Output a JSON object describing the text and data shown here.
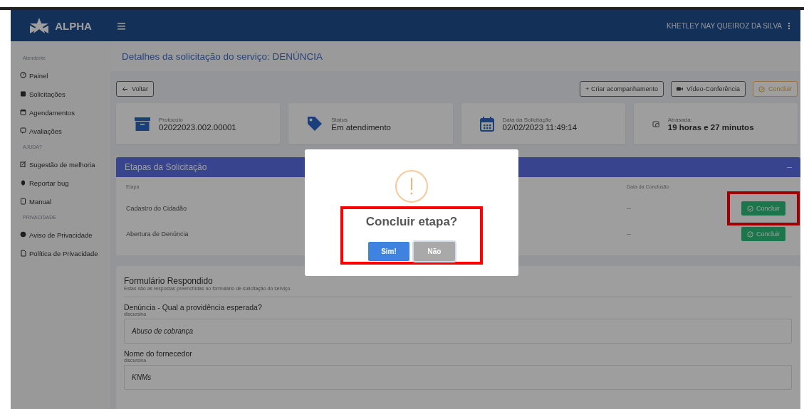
{
  "header": {
    "brand": "ALPHA",
    "user": "KHETLEY NAY QUEIROZ DA SILVA"
  },
  "sidebar": {
    "sections": [
      {
        "title": "Atendente",
        "items": [
          {
            "label": "Painel"
          },
          {
            "label": "Solicitações"
          },
          {
            "label": "Agendamentos"
          },
          {
            "label": "Avaliações"
          }
        ]
      },
      {
        "title": "AJUDA?",
        "items": [
          {
            "label": "Sugestão de melhoria"
          },
          {
            "label": "Reportar bug"
          },
          {
            "label": "Manual"
          }
        ]
      },
      {
        "title": "PRIVACIDADE",
        "items": [
          {
            "label": "Aviso de Privacidade"
          },
          {
            "label": "Política de Privacidade"
          }
        ]
      }
    ]
  },
  "page_title": "Detalhes da solicitação do serviço: DENÚNCIA",
  "toolbar": {
    "back": "Voltar",
    "actions": [
      {
        "label": "+ Criar acompanhamento",
        "kind": "plain"
      },
      {
        "label": "Vídeo-Conferência",
        "kind": "video"
      },
      {
        "label": "Concluir",
        "kind": "complete"
      }
    ]
  },
  "summary_cards": [
    {
      "label": "Protocolo",
      "value": "02022023.002.00001",
      "kind": "archive"
    },
    {
      "label": "Status",
      "value": "Em atendimento",
      "kind": "tag"
    },
    {
      "label": "Data da Solicitação",
      "value": "02/02/2023 11:49:14",
      "kind": "calendar"
    },
    {
      "label": "Atrasada:",
      "value": "19 horas e 27 minutos",
      "kind": "delay"
    }
  ],
  "steps_panel": {
    "title": "Etapas da Solicitação",
    "columns": [
      "Etapa",
      "Data da Conclusão"
    ],
    "rows": [
      {
        "name": "Cadastro do Cidadão",
        "date": "--",
        "action": "Concluir",
        "highlighted": true
      },
      {
        "name": "Abertura de Denúncia",
        "date": "--",
        "action": "Concluir",
        "highlighted": false
      }
    ]
  },
  "form": {
    "title": "Formulário Respondido",
    "subtitle": "Estas são as respostas preenchidas no formulário de solicitação do serviço.",
    "questions": [
      {
        "question": "Denúncia - Qual a providência esperada?",
        "type": "discursiva",
        "answer": "Abuso de cobrança"
      },
      {
        "question": "Nome do fornecedor",
        "type": "discursiva",
        "answer": "KNMs"
      }
    ]
  },
  "dialog": {
    "title": "Concluir etapa?",
    "highlighted": true,
    "buttons": [
      {
        "label": "Sim!",
        "kind": "confirm"
      },
      {
        "label": "Não",
        "kind": "cancel"
      }
    ]
  }
}
